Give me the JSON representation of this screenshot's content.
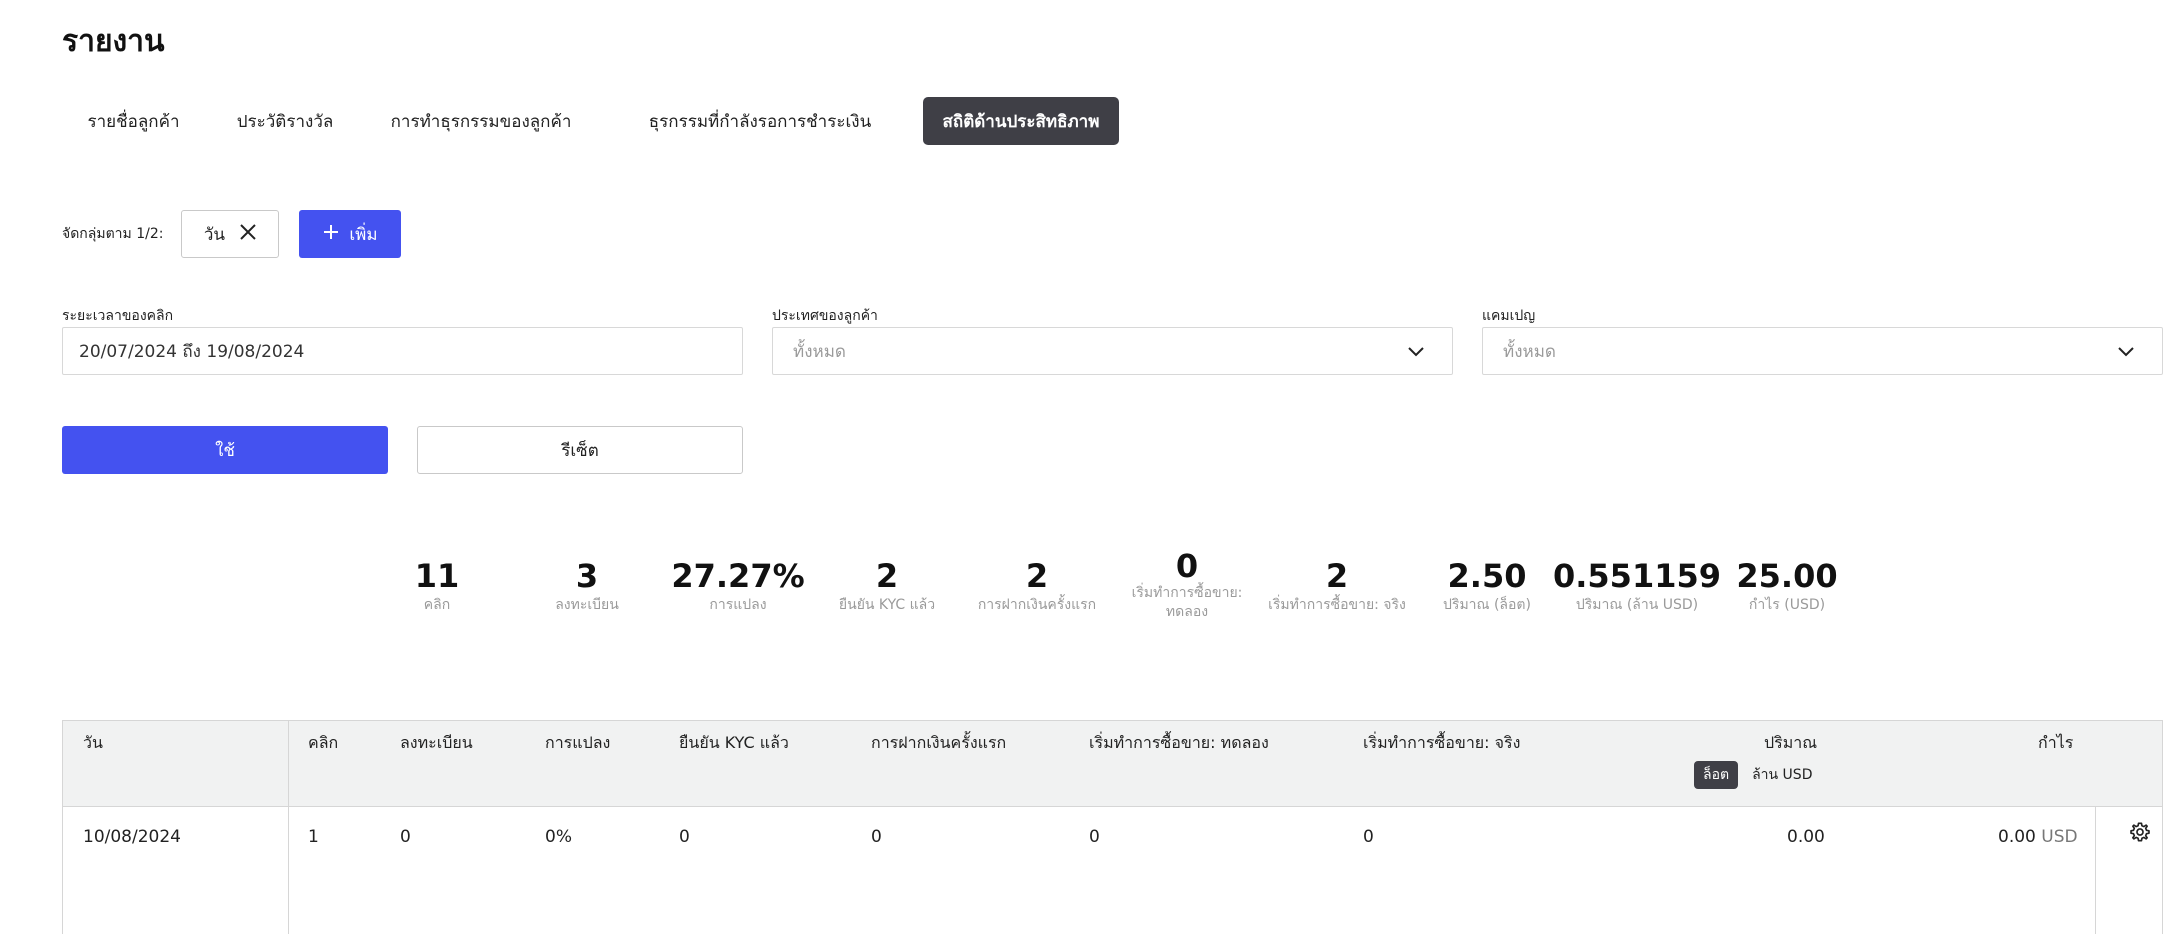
{
  "page": {
    "title": "รายงาน"
  },
  "tabs": [
    {
      "label": "รายชื่อลูกค้า",
      "active": false
    },
    {
      "label": "ประวัติรางวัล",
      "active": false
    },
    {
      "label": "การทำธุรกรรมของลูกค้า",
      "active": false
    },
    {
      "label": "ธุรกรรมที่กำลังรอการชำระเงิน",
      "active": false
    },
    {
      "label": "สถิติด้านประสิทธิภาพ",
      "active": true
    }
  ],
  "grouping": {
    "label": "จัดกลุ่มตาม 1/2:",
    "chip_label": "วัน",
    "add_label": "เพิ่ม"
  },
  "filters": {
    "click_period": {
      "label": "ระยะเวลาของคลิก",
      "value": "20/07/2024 ถึง 19/08/2024"
    },
    "client_country": {
      "label": "ประเทศของลูกค้า",
      "placeholder": "ทั้งหมด"
    },
    "campaign": {
      "label": "แคมเปญ",
      "placeholder": "ทั้งหมด"
    }
  },
  "actions": {
    "apply_label": "ใช้",
    "reset_label": "รีเซ็ต"
  },
  "stats": [
    {
      "value": "11",
      "label": "คลิก"
    },
    {
      "value": "3",
      "label": "ลงทะเบียน"
    },
    {
      "value": "27.27%",
      "label": "การแปลง"
    },
    {
      "value": "2",
      "label": "ยืนยัน KYC แล้ว"
    },
    {
      "value": "2",
      "label": "การฝากเงินครั้งแรก"
    },
    {
      "value": "0",
      "label_line1": "เริ่มทำการซื้อขาย:",
      "label_line2": "ทดลอง"
    },
    {
      "value": "2",
      "label": "เริ่มทำการซื้อขาย: จริง"
    },
    {
      "value": "2.50",
      "label": "ปริมาณ (ล็อต)"
    },
    {
      "value": "0.551159",
      "label": "ปริมาณ (ล้าน USD)"
    },
    {
      "value": "25.00",
      "label": "กำไร (USD)"
    }
  ],
  "table": {
    "headers": {
      "day": "วัน",
      "clicks": "คลิก",
      "registrations": "ลงทะเบียน",
      "conversion": "การแปลง",
      "kyc": "ยืนยัน KYC แล้ว",
      "first_deposit": "การฝากเงินครั้งแรก",
      "demo_trading": "เริ่มทำการซื้อขาย: ทดลอง",
      "real_trading": "เริ่มทำการซื้อขาย: จริง",
      "volume": "ปริมาณ",
      "profit": "กำไร"
    },
    "volume_units": {
      "active": "ล็อต",
      "inactive": "ล้าน USD"
    },
    "rows": [
      {
        "day": "10/08/2024",
        "clicks": "1",
        "registrations": "0",
        "conversion": "0%",
        "kyc": "0",
        "first_deposit": "0",
        "demo_trading": "0",
        "real_trading": "0",
        "volume": "0.00",
        "profit": "0.00",
        "profit_currency": "USD"
      }
    ]
  },
  "colors": {
    "accent": "#4452f0",
    "active_tab": "#3f3f46",
    "header_bg": "#f1f2f2"
  }
}
